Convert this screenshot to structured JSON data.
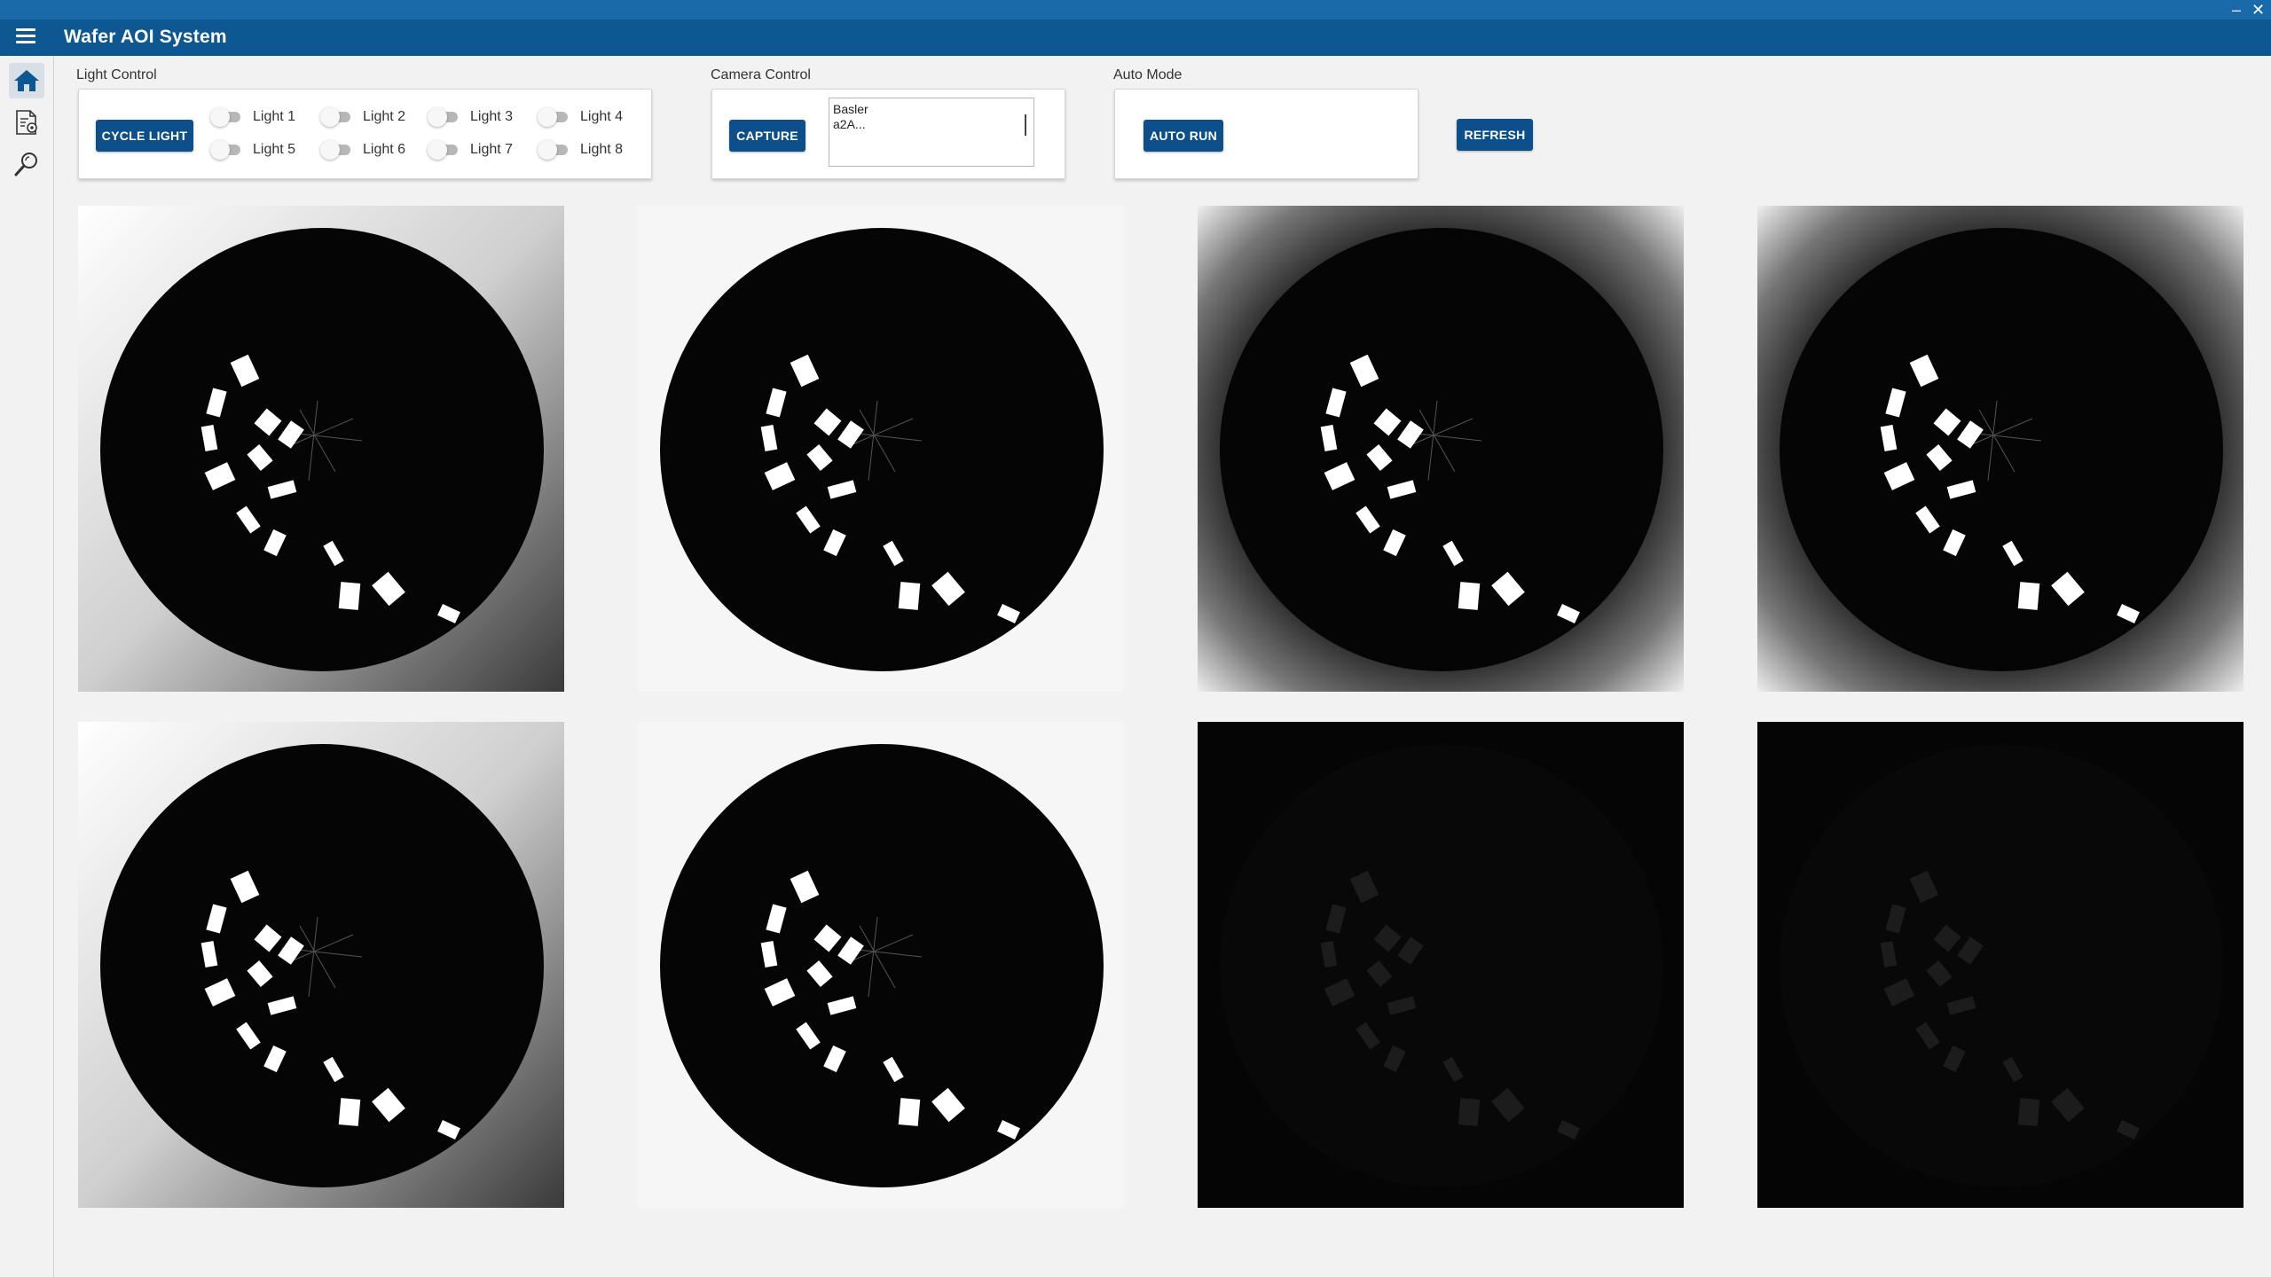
{
  "app": {
    "title": "Wafer AOI System",
    "window_buttons": [
      "–",
      "✕"
    ]
  },
  "sidebar": {
    "items": [
      {
        "name": "home",
        "icon": "home-icon",
        "active": true
      },
      {
        "name": "recipe-settings",
        "icon": "document-gear-icon",
        "active": false
      },
      {
        "name": "inspect",
        "icon": "magnifier-icon",
        "active": false
      }
    ]
  },
  "light_control": {
    "label": "Light Control",
    "cycle_button": "CYCLE LIGHT",
    "lights": [
      {
        "label": "Light 1",
        "on": false
      },
      {
        "label": "Light 2",
        "on": false
      },
      {
        "label": "Light 3",
        "on": false
      },
      {
        "label": "Light 4",
        "on": false
      },
      {
        "label": "Light 5",
        "on": false
      },
      {
        "label": "Light 6",
        "on": false
      },
      {
        "label": "Light 7",
        "on": false
      },
      {
        "label": "Light 8",
        "on": false
      }
    ]
  },
  "camera_control": {
    "label": "Camera Control",
    "capture_button": "CAPTURE",
    "camera_list": [
      "Basler",
      "a2A..."
    ]
  },
  "auto_mode": {
    "label": "Auto Mode",
    "auto_run_button": "AUTO RUN"
  },
  "refresh_button": "REFRESH",
  "captures": [
    {
      "index": 1,
      "brightness": "bright-gradient"
    },
    {
      "index": 2,
      "brightness": "bright"
    },
    {
      "index": 3,
      "brightness": "bright-vignette"
    },
    {
      "index": 4,
      "brightness": "bright-vignette"
    },
    {
      "index": 5,
      "brightness": "bright-gradient"
    },
    {
      "index": 6,
      "brightness": "bright"
    },
    {
      "index": 7,
      "brightness": "dark"
    },
    {
      "index": 8,
      "brightness": "dark"
    }
  ],
  "colors": {
    "titlebar": "#0d5792",
    "button": "#0d4f8b",
    "background": "#f2f2f2"
  }
}
